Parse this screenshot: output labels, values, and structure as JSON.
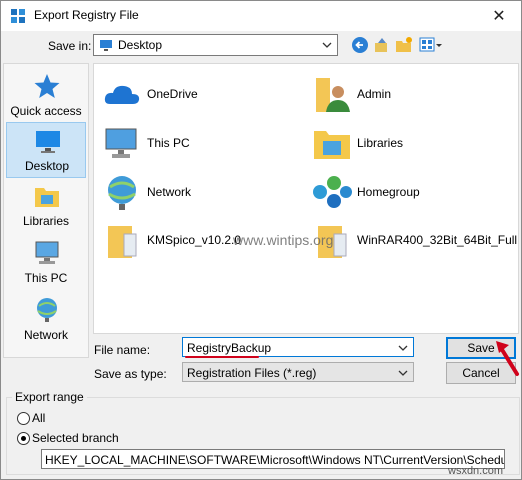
{
  "window": {
    "title": "Export Registry File",
    "close_symbol": "✕"
  },
  "save_in": {
    "label": "Save in:",
    "value": "Desktop"
  },
  "toolbar": {
    "back_icon": "back-arrow-icon",
    "up_icon": "up-folder-icon",
    "new_folder_icon": "new-folder-icon",
    "view_icon": "view-menu-icon"
  },
  "places": [
    {
      "label": "Quick access",
      "icon": "star-icon"
    },
    {
      "label": "Desktop",
      "icon": "desktop-icon",
      "selected": true
    },
    {
      "label": "Libraries",
      "icon": "libraries-icon"
    },
    {
      "label": "This PC",
      "icon": "computer-icon"
    },
    {
      "label": "Network",
      "icon": "network-icon"
    }
  ],
  "files": [
    {
      "label": "OneDrive",
      "icon": "cloud-icon"
    },
    {
      "label": "Admin",
      "icon": "user-folder-icon"
    },
    {
      "label": "This PC",
      "icon": "computer-icon"
    },
    {
      "label": "Libraries",
      "icon": "libraries-icon"
    },
    {
      "label": "Network",
      "icon": "network-icon"
    },
    {
      "label": "Homegroup",
      "icon": "homegroup-icon"
    },
    {
      "label": "KMSpico_v10.2.0",
      "icon": "folder-icon"
    },
    {
      "label": "WinRAR400_32Bit_64Bit_Full",
      "icon": "folder-icon"
    }
  ],
  "file_name": {
    "label": "File name:",
    "value": "RegistryBackup"
  },
  "save_as_type": {
    "label": "Save as type:",
    "value": "Registration Files (*.reg)"
  },
  "buttons": {
    "save": "Save",
    "cancel": "Cancel"
  },
  "export_range": {
    "label": "Export range",
    "options": [
      {
        "label": "All",
        "checked": false
      },
      {
        "label": "Selected branch",
        "checked": true
      }
    ],
    "branch_value": "HKEY_LOCAL_MACHINE\\SOFTWARE\\Microsoft\\Windows NT\\CurrentVersion\\Schedule\\TaskCache\\Tree\\"
  },
  "watermarks": {
    "center": "www.wintips.org",
    "corner": "wsxdn.com"
  },
  "colors": {
    "accent": "#0078d7",
    "selection": "#cce4f7",
    "pointer": "#d0021b"
  }
}
